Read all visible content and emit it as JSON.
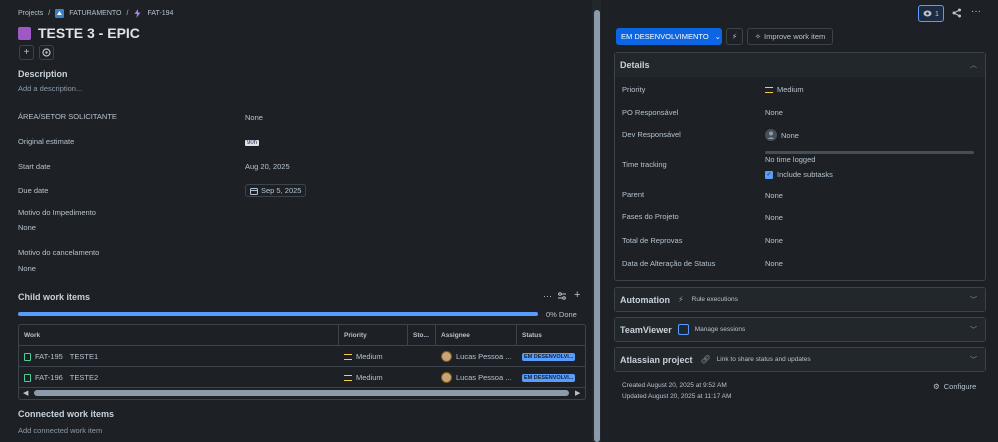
{
  "breadcrumbs": {
    "projects": "Projects",
    "sep": "/",
    "project": "FATURAMENTO",
    "issue": "FAT-194"
  },
  "issue": {
    "title": "TESTE 3 - EPIC"
  },
  "description": {
    "heading": "Description",
    "placeholder": "Add a description..."
  },
  "fields": {
    "area_label": "ÁREA/SETOR SOLICITANTE",
    "area_value": "None",
    "estimate_label": "Original estimate",
    "estimate_value": "90h",
    "start_label": "Start date",
    "start_value": "Aug 20, 2025",
    "due_label": "Due date",
    "due_value": "Sep 5, 2025",
    "impedimento_label": "Motivo do Impedimento",
    "impedimento_value": "None",
    "cancelamento_label": "Motivo do cancelamento",
    "cancelamento_value": "None"
  },
  "child": {
    "heading": "Child work items",
    "progress_text": "0% Done",
    "progress_pct": 0,
    "columns": {
      "work": "Work",
      "priority": "Priority",
      "story": "Sto...",
      "assignee": "Assignee",
      "status": "Status"
    },
    "rows": [
      {
        "key": "FAT-195",
        "summary": "TESTE1",
        "priority": "Medium",
        "assignee": "Lucas Pessoa ...",
        "status": "EM DESENVOLVI..."
      },
      {
        "key": "FAT-196",
        "summary": "TESTE2",
        "priority": "Medium",
        "assignee": "Lucas Pessoa ...",
        "status": "EM DESENVOLVI..."
      }
    ]
  },
  "connected": {
    "heading": "Connected work items",
    "placeholder": "Add connected work item"
  },
  "topbar": {
    "watch_count": "1"
  },
  "status_button": {
    "label": "EM DESENVOLVIMENTO"
  },
  "improve_button": {
    "label": "Improve work item"
  },
  "details": {
    "heading": "Details",
    "priority_label": "Priority",
    "priority_value": "Medium",
    "po_label": "PO Responsável",
    "po_value": "None",
    "dev_label": "Dev Responsável",
    "dev_value": "None",
    "time_label": "Time tracking",
    "time_value": "No time logged",
    "subtasks_label": "Include subtasks",
    "parent_label": "Parent",
    "parent_value": "None",
    "fases_label": "Fases do Projeto",
    "fases_value": "None",
    "reprovas_label": "Total de Reprovas",
    "reprovas_value": "None",
    "alteracao_label": "Data de Alteração de Status",
    "alteracao_value": "None"
  },
  "automation": {
    "heading": "Automation",
    "sub": "Rule executions"
  },
  "teamviewer": {
    "heading": "TeamViewer",
    "sub": "Manage sessions"
  },
  "atlassian": {
    "heading": "Atlassian project",
    "sub": "Link to share status and updates"
  },
  "footer": {
    "created": "Created August 20, 2025 at 9:52 AM",
    "updated": "Updated August 20, 2025 at 11:17 AM",
    "configure": "Configure"
  },
  "colors": {
    "accent": "#0c66e4",
    "progress": "#579dff",
    "epic": "#9f59c4",
    "story": "#4bce97",
    "priority_medium": "#f5cd47"
  }
}
